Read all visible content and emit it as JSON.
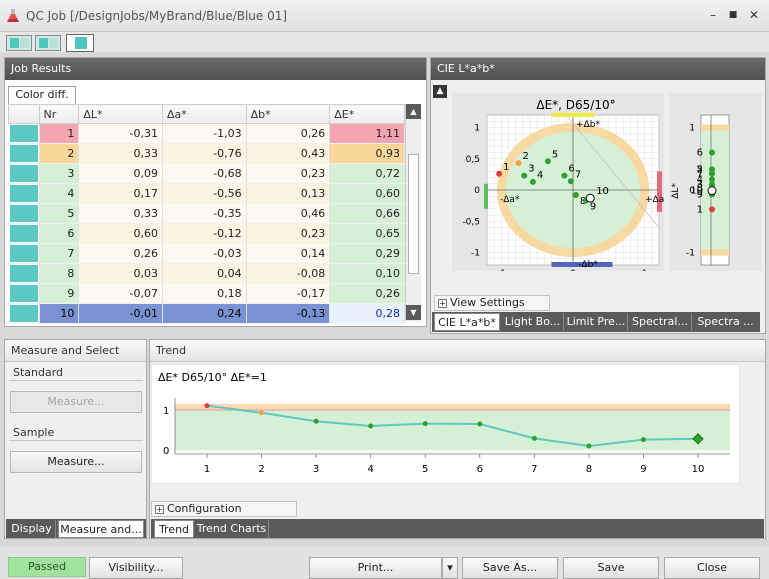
{
  "window": {
    "title": "QC Job [/DesignJobs/MyBrand/Blue/Blue 01]",
    "minimize_glyph": "–",
    "maximize_glyph": "■",
    "close_glyph": "✕"
  },
  "icons": {
    "app": "flask-icon",
    "scroll_up": "triangle-up-icon",
    "scroll_down": "triangle-down-icon",
    "collapse": "chevron-up-icon",
    "expand": "plus-box-icon"
  },
  "colors": {
    "swatch": "#5bc8c2",
    "fail_red": "#f4a5b0",
    "warn_orange": "#f9d79b",
    "pass_green": "#d6f0d6",
    "selected_blue": "#7b92d2",
    "passed_badge": "#9fe39f"
  },
  "job_results": {
    "header": "Job Results",
    "tab": "Color diff.",
    "columns": [
      "Nr",
      "ΔL*",
      "Δa*",
      "Δb*",
      "ΔE*"
    ],
    "rows": [
      {
        "nr": "1",
        "dl": "-0,31",
        "da": "-1,03",
        "db": "0,26",
        "de": "1,11",
        "status": "fail"
      },
      {
        "nr": "2",
        "dl": "0,33",
        "da": "-0,76",
        "db": "0,43",
        "de": "0,93",
        "status": "warn"
      },
      {
        "nr": "3",
        "dl": "0,09",
        "da": "-0,68",
        "db": "0,23",
        "de": "0,72",
        "status": "pass"
      },
      {
        "nr": "4",
        "dl": "0,17",
        "da": "-0,56",
        "db": "0,13",
        "de": "0,60",
        "status": "pass"
      },
      {
        "nr": "5",
        "dl": "0,33",
        "da": "-0,35",
        "db": "0,46",
        "de": "0,66",
        "status": "pass"
      },
      {
        "nr": "6",
        "dl": "0,60",
        "da": "-0,12",
        "db": "0,23",
        "de": "0,65",
        "status": "pass"
      },
      {
        "nr": "7",
        "dl": "0,26",
        "da": "-0,03",
        "db": "0,14",
        "de": "0,29",
        "status": "pass"
      },
      {
        "nr": "8",
        "dl": "0,03",
        "da": "0,04",
        "db": "-0,08",
        "de": "0,10",
        "status": "pass"
      },
      {
        "nr": "9",
        "dl": "-0,07",
        "da": "0,18",
        "db": "-0,17",
        "de": "0,26",
        "status": "pass"
      },
      {
        "nr": "10",
        "dl": "-0,01",
        "da": "0,24",
        "db": "-0,13",
        "de": "0,28",
        "status": "selected"
      }
    ]
  },
  "cie_panel": {
    "header": "CIE L*a*b*",
    "chart_title": "ΔE*, D65/10°",
    "label_pos_b": "+Δb*",
    "label_neg_b": "-Δb*",
    "label_pos_a": "+Δa",
    "label_neg_a": "-Δa*",
    "label_dl": "ΔL*",
    "view_settings": "View Settings",
    "tabs": [
      "CIE L*a*b*",
      "Light Bo...",
      "Limit Pre...",
      "Spectral...",
      "Spectra ..."
    ]
  },
  "chart_data": [
    {
      "type": "scatter",
      "title": "ΔE*, D65/10°",
      "xlabel": "",
      "ylabel": "",
      "xlim": [
        -1.2,
        1.2
      ],
      "ylim": [
        -1.2,
        1.2
      ],
      "x_ticks": [
        "-1",
        "0",
        "1"
      ],
      "y_ticks": [
        "1",
        "0,5",
        "0",
        "-0,5",
        "-1"
      ],
      "grid": true,
      "tolerance_radius": 1,
      "points": [
        {
          "label": "1",
          "x": -1.03,
          "y": 0.26,
          "status": "fail"
        },
        {
          "label": "2",
          "x": -0.76,
          "y": 0.43,
          "status": "warn"
        },
        {
          "label": "3",
          "x": -0.68,
          "y": 0.23,
          "status": "pass"
        },
        {
          "label": "4",
          "x": -0.56,
          "y": 0.13,
          "status": "pass"
        },
        {
          "label": "5",
          "x": -0.35,
          "y": 0.46,
          "status": "pass"
        },
        {
          "label": "6",
          "x": -0.12,
          "y": 0.23,
          "status": "pass"
        },
        {
          "label": "7",
          "x": -0.03,
          "y": 0.14,
          "status": "pass"
        },
        {
          "label": "8",
          "x": 0.04,
          "y": -0.08,
          "status": "pass"
        },
        {
          "label": "9",
          "x": 0.18,
          "y": -0.17,
          "status": "pass"
        },
        {
          "label": "10",
          "x": 0.24,
          "y": -0.13,
          "status": "selected"
        }
      ]
    },
    {
      "type": "scatter",
      "title": "",
      "xlabel": "",
      "ylabel": "ΔL*",
      "ylim": [
        -1.2,
        1.2
      ],
      "y_ticks": [
        "1",
        "0",
        "-1"
      ],
      "points": [
        {
          "label": "1",
          "y": -0.31,
          "status": "fail"
        },
        {
          "label": "2",
          "y": 0.33,
          "status": "warn"
        },
        {
          "label": "3",
          "y": 0.09,
          "status": "pass"
        },
        {
          "label": "4",
          "y": 0.17,
          "status": "pass"
        },
        {
          "label": "5",
          "y": 0.33,
          "status": "pass"
        },
        {
          "label": "6",
          "y": 0.6,
          "status": "pass"
        },
        {
          "label": "7",
          "y": 0.26,
          "status": "pass"
        },
        {
          "label": "8",
          "y": 0.03,
          "status": "pass"
        },
        {
          "label": "9",
          "y": -0.07,
          "status": "pass"
        },
        {
          "label": "10",
          "y": -0.01,
          "status": "selected"
        }
      ]
    },
    {
      "type": "line",
      "title": "ΔE* D65/10° ΔE*=1",
      "xlabel": "",
      "ylabel": "",
      "categories": [
        "1",
        "2",
        "3",
        "4",
        "5",
        "6",
        "7",
        "8",
        "9",
        "10"
      ],
      "values": [
        1.11,
        0.93,
        0.72,
        0.6,
        0.66,
        0.65,
        0.29,
        0.1,
        0.26,
        0.28
      ],
      "y_ticks": [
        "1",
        "0"
      ],
      "ylim": [
        -0.1,
        1.3
      ],
      "threshold": 1,
      "warn_band": [
        1,
        1.15
      ]
    }
  ],
  "measure_select": {
    "header": "Measure and Select",
    "standard_label": "Standard",
    "standard_button": "Measure...",
    "sample_label": "Sample",
    "sample_button": "Measure...",
    "tabs": [
      "Display",
      "Measure and..."
    ]
  },
  "trend": {
    "header": "Trend",
    "configuration": "Configuration",
    "tabs": [
      "Trend",
      "Trend Charts"
    ]
  },
  "footer": {
    "status": "Passed",
    "visibility": "Visibility...",
    "print": "Print...",
    "print_arrow": "▾",
    "save_as": "Save As...",
    "save": "Save",
    "close": "Close"
  }
}
